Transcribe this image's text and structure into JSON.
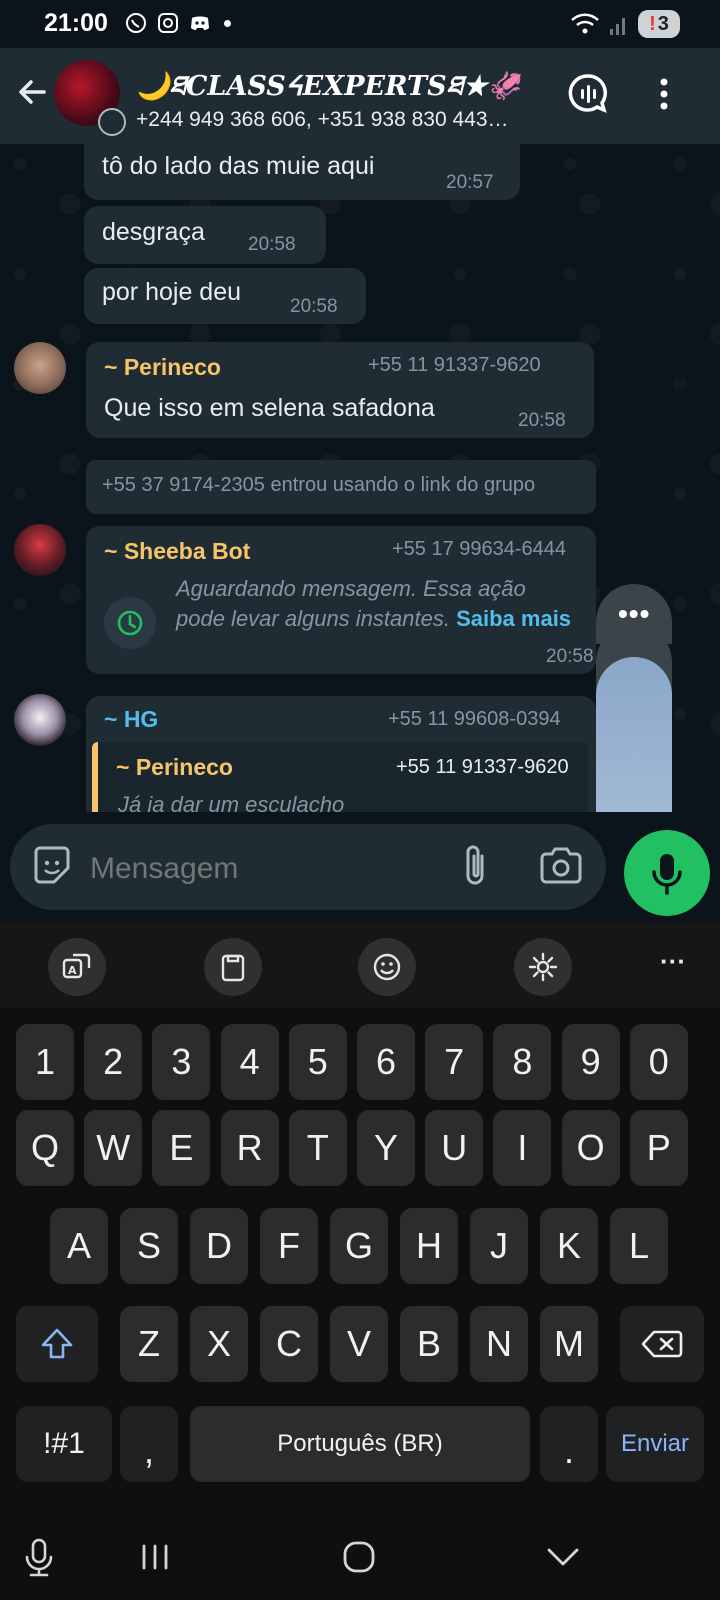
{
  "status_bar": {
    "time": "21:00",
    "icons": [
      "whatsapp-icon",
      "instagram-icon",
      "discord-icon"
    ],
    "battery": "3"
  },
  "header": {
    "title": "🌙ཐCLASSᔦEXPERTSཐ★🦑",
    "subtitle": "+244 949 368 606, +351 938 830 443…"
  },
  "messages": [
    {
      "text": "tô do lado das muie aqui",
      "time": "20:57"
    },
    {
      "text": "desgraça",
      "time": "20:58"
    },
    {
      "text": "por hoje deu",
      "time": "20:58"
    },
    {
      "sender": "~ Perineco",
      "phone": "+55 11 91337-9620",
      "text": "Que isso em selena safadona",
      "time": "20:58"
    }
  ],
  "system_message": "+55 37 9174-2305 entrou usando o link do grupo",
  "bot_message": {
    "sender": "~ Sheeba Bot",
    "phone": "+55 17 99634-6444",
    "text": "Aguardando mensagem. Essa ação pode levar alguns instantes.",
    "link": "Saiba mais",
    "time": "20:58"
  },
  "reply_message": {
    "sender": "~ HG",
    "phone": "+55 11 99608-0394",
    "quoted_sender": "~ Perineco",
    "quoted_phone": "+55 11 91337-9620",
    "quoted_preview": "Já ia dar um esculacho"
  },
  "volume": {
    "level": 0.9
  },
  "input": {
    "placeholder": "Mensagem"
  },
  "keyboard": {
    "numbers": [
      "1",
      "2",
      "3",
      "4",
      "5",
      "6",
      "7",
      "8",
      "9",
      "0"
    ],
    "row1": [
      "Q",
      "W",
      "E",
      "R",
      "T",
      "Y",
      "U",
      "I",
      "O",
      "P"
    ],
    "row2": [
      "A",
      "S",
      "D",
      "F",
      "G",
      "H",
      "J",
      "K",
      "L"
    ],
    "row3": [
      "Z",
      "X",
      "C",
      "V",
      "B",
      "N",
      "M"
    ],
    "symbols": "!#1",
    "comma": ",",
    "space": "Português (BR)",
    "period": ".",
    "enter": "Enviar",
    "more": "···"
  },
  "colors": {
    "accent_green": "#21c063",
    "sender_orange": "#f7c469",
    "sender_blue": "#53bdeb",
    "bubble": "#1f2c34"
  }
}
